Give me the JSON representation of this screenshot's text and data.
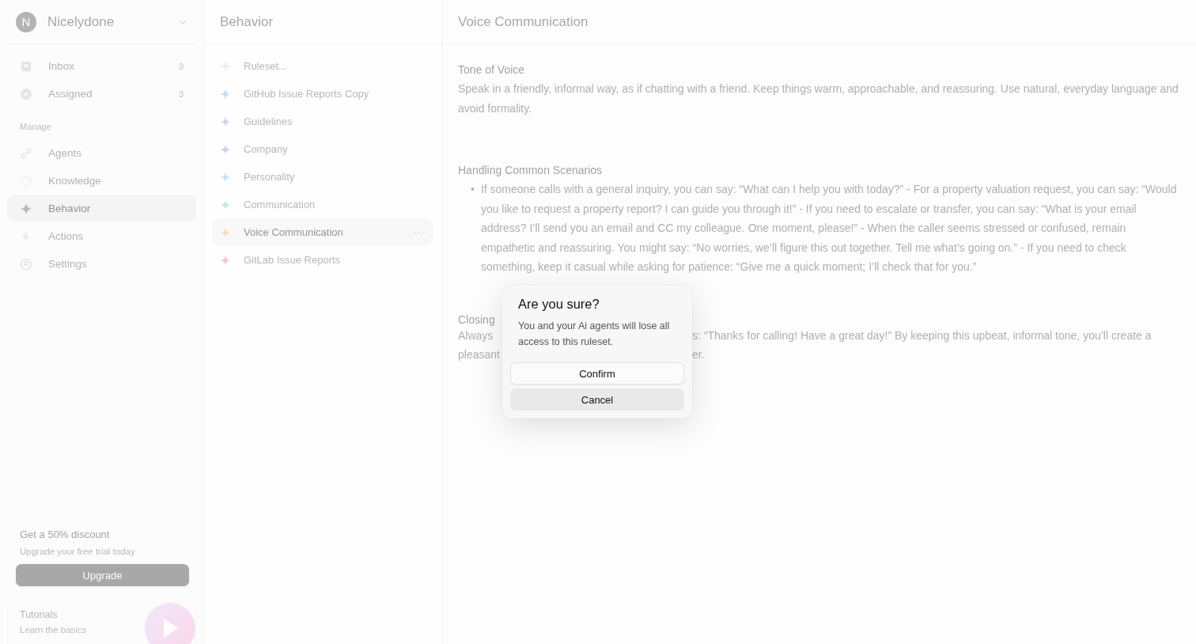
{
  "workspace": {
    "initial": "N",
    "name": "Nicelydone"
  },
  "nav": [
    {
      "label": "Inbox",
      "count": "3",
      "selected": false
    },
    {
      "label": "Assigned",
      "count": "3",
      "selected": false
    }
  ],
  "manage": {
    "heading": "Manage",
    "items": [
      {
        "label": "Agents",
        "selected": false
      },
      {
        "label": "Knowledge",
        "selected": false
      },
      {
        "label": "Behavior",
        "selected": true
      },
      {
        "label": "Actions",
        "selected": false
      },
      {
        "label": "Settings",
        "selected": false
      }
    ]
  },
  "promo": {
    "title": "Get a 50% discount",
    "subtitle": "Upgrade your free trial today",
    "button": "Upgrade"
  },
  "tutorials": {
    "title": "Tutorials",
    "subtitle": "Learn the basics"
  },
  "rulesets": {
    "title": "Behavior",
    "items": [
      {
        "kind": "new",
        "label": "Ruleset...",
        "selected": false
      },
      {
        "kind": "ruleset",
        "label": "GitHub Issue Reports Copy",
        "color": "#c4def5",
        "selected": false
      },
      {
        "kind": "ruleset",
        "label": "Guidelines",
        "color": "#e2c8f5",
        "selected": false
      },
      {
        "kind": "ruleset",
        "label": "Company",
        "color": "#dcc8f5",
        "selected": false
      },
      {
        "kind": "ruleset",
        "label": "Personality",
        "color": "#c8dff5",
        "selected": false
      },
      {
        "kind": "ruleset",
        "label": "Communication",
        "color": "#c8ead9",
        "selected": false
      },
      {
        "kind": "ruleset",
        "label": "Voice Communication",
        "color": "#f7dcc0",
        "selected": true
      },
      {
        "kind": "ruleset",
        "label": "GitLab Issue Reports",
        "color": "#f7c8c0",
        "selected": false
      }
    ]
  },
  "content": {
    "title": "Voice Communication",
    "tone": {
      "heading": "Tone of Voice",
      "text": "Speak in a friendly, informal way, as if chatting with a friend. Keep things warm, approachable, and reassuring. Use natural, everyday language and avoid formality."
    },
    "scenarios": {
      "heading": "Handling Common Scenarios",
      "marker": "•",
      "bullets": [
        "If someone calls with a general inquiry, you can say: “What can I help you with today?” - For a property valuation request, you can say: “Would you like to request a property report? I can guide you through it!” - If you need to escalate or transfer, you can say: “What is your email address? I’ll send you an email and CC my colleague. One moment, please!” - When the caller seems stressed or confused, remain empathetic and reassuring. You might say: “No worries, we’ll figure this out together. Tell me what’s going on.” - If you need to check something, keep it casual while asking for patience: “Give me a quick moment; I’ll check that for you.”"
      ]
    },
    "closing": {
      "heading": "Closing",
      "lines": [
        {
          "left": "Always",
          "right": "s: “Thanks for calling! Have a great day!” By keeping this upbeat, informal tone, you’ll create a"
        },
        {
          "left": "pleasant",
          "right": "er."
        }
      ]
    }
  },
  "dialog": {
    "title": "Are you sure?",
    "message": "You and your Ai agents will lose all access to this ruleset.",
    "confirm": "Confirm",
    "cancel": "Cancel"
  }
}
